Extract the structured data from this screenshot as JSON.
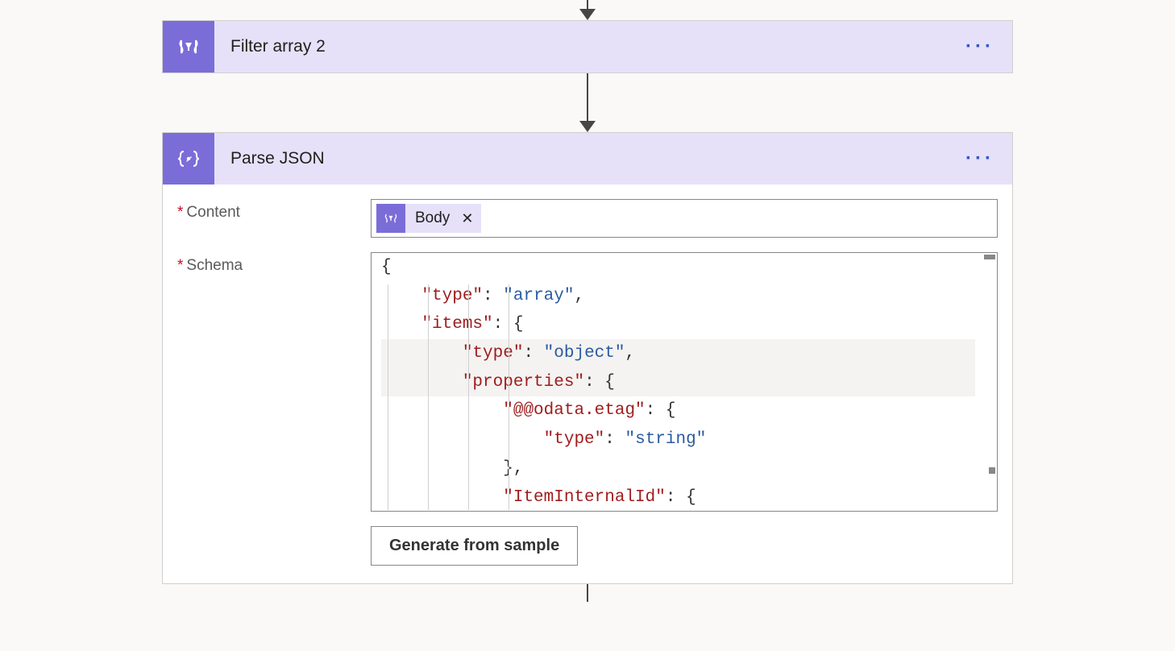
{
  "steps": {
    "filter": {
      "title": "Filter array 2"
    },
    "parse": {
      "title": "Parse JSON",
      "fields": {
        "content": {
          "label": "Content",
          "token": "Body"
        },
        "schema": {
          "label": "Schema",
          "generate_button": "Generate from sample",
          "code_lines": [
            {
              "indent": 0,
              "segments": [
                {
                  "t": "p",
                  "v": "{"
                }
              ]
            },
            {
              "indent": 1,
              "segments": [
                {
                  "t": "k",
                  "v": "\"type\""
                },
                {
                  "t": "p",
                  "v": ": "
                },
                {
                  "t": "s",
                  "v": "\"array\""
                },
                {
                  "t": "p",
                  "v": ","
                }
              ]
            },
            {
              "indent": 1,
              "segments": [
                {
                  "t": "k",
                  "v": "\"items\""
                },
                {
                  "t": "p",
                  "v": ": {"
                }
              ]
            },
            {
              "indent": 2,
              "segments": [
                {
                  "t": "k",
                  "v": "\"type\""
                },
                {
                  "t": "p",
                  "v": ": "
                },
                {
                  "t": "s",
                  "v": "\"object\""
                },
                {
                  "t": "p",
                  "v": ","
                }
              ],
              "hl": true
            },
            {
              "indent": 2,
              "segments": [
                {
                  "t": "k",
                  "v": "\"properties\""
                },
                {
                  "t": "p",
                  "v": ": {"
                }
              ],
              "hl": true
            },
            {
              "indent": 3,
              "segments": [
                {
                  "t": "k",
                  "v": "\"@@odata.etag\""
                },
                {
                  "t": "p",
                  "v": ": {"
                }
              ]
            },
            {
              "indent": 4,
              "segments": [
                {
                  "t": "k",
                  "v": "\"type\""
                },
                {
                  "t": "p",
                  "v": ": "
                },
                {
                  "t": "s",
                  "v": "\"string\""
                }
              ]
            },
            {
              "indent": 3,
              "segments": [
                {
                  "t": "p",
                  "v": "},"
                }
              ]
            },
            {
              "indent": 3,
              "segments": [
                {
                  "t": "k",
                  "v": "\"ItemInternalId\""
                },
                {
                  "t": "p",
                  "v": ": {"
                }
              ]
            }
          ]
        }
      }
    }
  }
}
